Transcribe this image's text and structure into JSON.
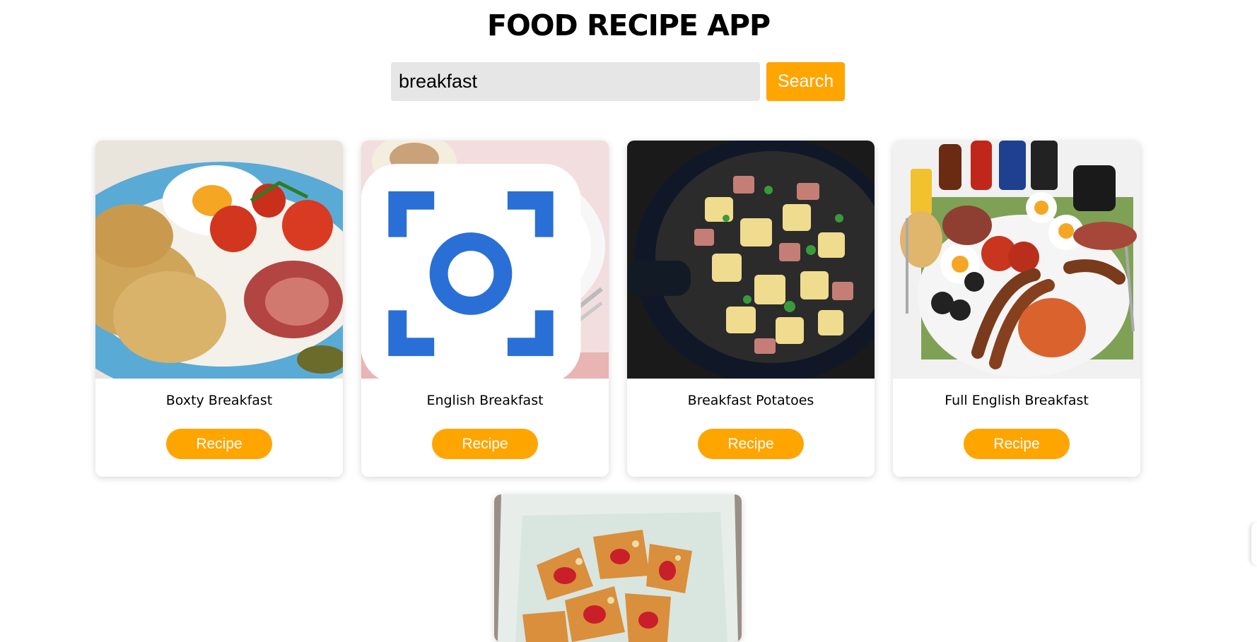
{
  "app": {
    "title": "FOOD RECIPE APP"
  },
  "search": {
    "value": "breakfast",
    "button_label": "Search"
  },
  "colors": {
    "accent": "#ffa500",
    "input_bg": "#e6e6e6"
  },
  "meals": [
    {
      "name": "Boxty Breakfast",
      "button_label": "Recipe",
      "image": "boxty-breakfast-photo"
    },
    {
      "name": "English Breakfast",
      "button_label": "Recipe",
      "image": "english-breakfast-photo"
    },
    {
      "name": "Breakfast Potatoes",
      "button_label": "Recipe",
      "image": "breakfast-potatoes-photo"
    },
    {
      "name": "Full English Breakfast",
      "button_label": "Recipe",
      "image": "full-english-breakfast-photo"
    },
    {
      "name": "",
      "button_label": "",
      "image": "pastries-photo"
    }
  ]
}
